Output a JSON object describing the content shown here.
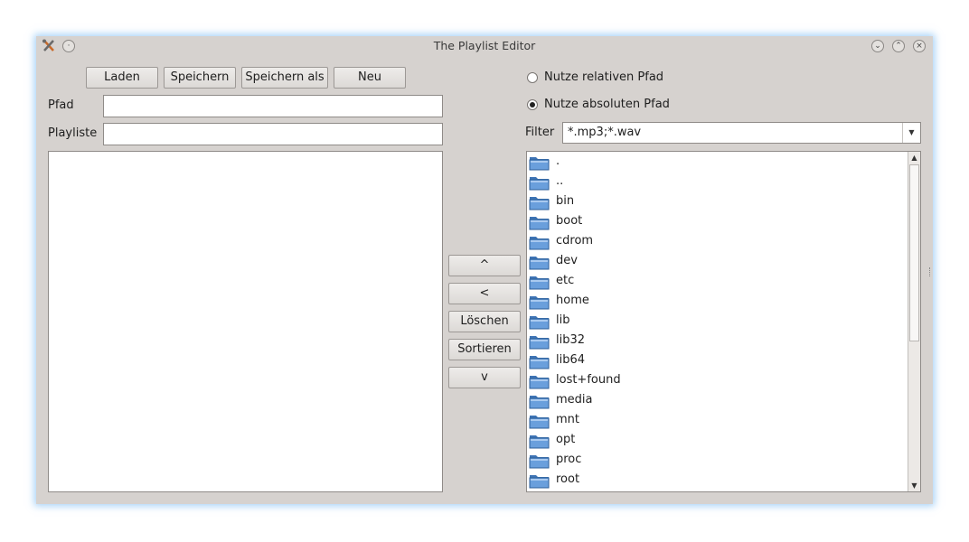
{
  "window": {
    "title": "The Playlist Editor"
  },
  "toolbar": {
    "load": "Laden",
    "save": "Speichern",
    "save_as": "Speichern als",
    "new": "Neu"
  },
  "form": {
    "path_label": "Pfad",
    "path_value": "",
    "playlist_label": "Playliste",
    "playlist_value": ""
  },
  "middle": {
    "up": "^",
    "add": "<",
    "delete": "Löschen",
    "sort": "Sortieren",
    "down": "v"
  },
  "options": {
    "relative": "Nutze relativen Pfad",
    "absolute": "Nutze absoluten Pfad",
    "selected": "absolute"
  },
  "filter": {
    "label": "Filter",
    "value": "*.mp3;*.wav"
  },
  "tree": {
    "items": [
      ".",
      "..",
      "bin",
      "boot",
      "cdrom",
      "dev",
      "etc",
      "home",
      "lib",
      "lib32",
      "lib64",
      "lost+found",
      "media",
      "mnt",
      "opt",
      "proc",
      "root"
    ]
  },
  "colors": {
    "window_bg": "#d6d2cf",
    "folder_blue": "#4f86c6",
    "glow": "#5aaaf0"
  }
}
